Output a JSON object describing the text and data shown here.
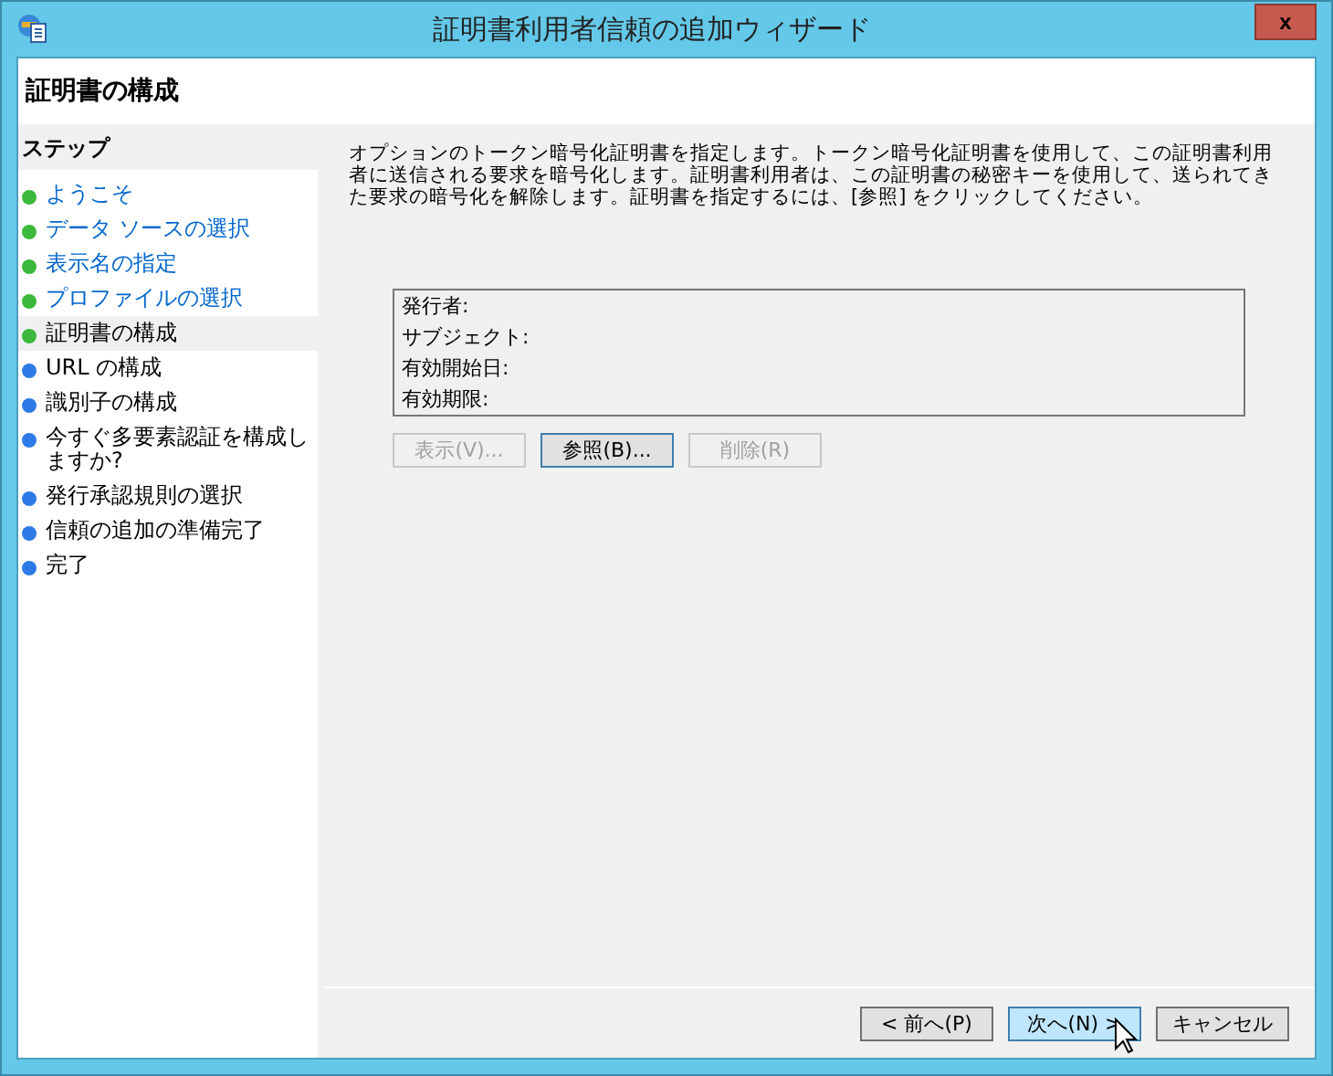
{
  "window": {
    "title": "証明書利用者信頼の追加ウィザード",
    "close": "x"
  },
  "header": {
    "title": "証明書の構成"
  },
  "sidebar": {
    "heading": "ステップ",
    "items": [
      {
        "label": "ようこそ",
        "color": "#3cb83c",
        "completed": true,
        "selected": false
      },
      {
        "label": "データ ソースの選択",
        "color": "#3cb83c",
        "completed": true,
        "selected": false
      },
      {
        "label": "表示名の指定",
        "color": "#3cb83c",
        "completed": true,
        "selected": false
      },
      {
        "label": "プロファイルの選択",
        "color": "#3cb83c",
        "completed": true,
        "selected": false
      },
      {
        "label": "証明書の構成",
        "color": "#3cb83c",
        "completed": false,
        "selected": true
      },
      {
        "label": "URL の構成",
        "color": "#2e7be8",
        "completed": false,
        "selected": false
      },
      {
        "label": "識別子の構成",
        "color": "#2e7be8",
        "completed": false,
        "selected": false
      },
      {
        "label": "今すぐ多要素認証を構成しますか?",
        "color": "#2e7be8",
        "completed": false,
        "selected": false
      },
      {
        "label": "発行承認規則の選択",
        "color": "#2e7be8",
        "completed": false,
        "selected": false
      },
      {
        "label": "信頼の追加の準備完了",
        "color": "#2e7be8",
        "completed": false,
        "selected": false
      },
      {
        "label": "完了",
        "color": "#2e7be8",
        "completed": false,
        "selected": false
      }
    ]
  },
  "content": {
    "description": "オプションのトークン暗号化証明書を指定します。トークン暗号化証明書を使用して、この証明書利用者に送信される要求を暗号化します。証明書利用者は、この証明書の秘密キーを使用して、送られてきた要求の暗号化を解除します。証明書を指定するには、[参照] をクリックしてください。",
    "certificate_fields": [
      "発行者:",
      "サブジェクト:",
      "有効開始日:",
      "有効期限:"
    ],
    "buttons": [
      {
        "label": "表示(V)...",
        "disabled": true,
        "default": false
      },
      {
        "label": "参照(B)...",
        "disabled": false,
        "default": true
      },
      {
        "label": "削除(R)",
        "disabled": true,
        "default": false
      }
    ]
  },
  "footer": {
    "buttons": [
      {
        "label": "< 前へ(P)",
        "disabled": false,
        "hovered": false
      },
      {
        "label": "次へ(N) >",
        "disabled": false,
        "hovered": true
      },
      {
        "label": "キャンセル",
        "disabled": false,
        "hovered": false
      }
    ]
  }
}
